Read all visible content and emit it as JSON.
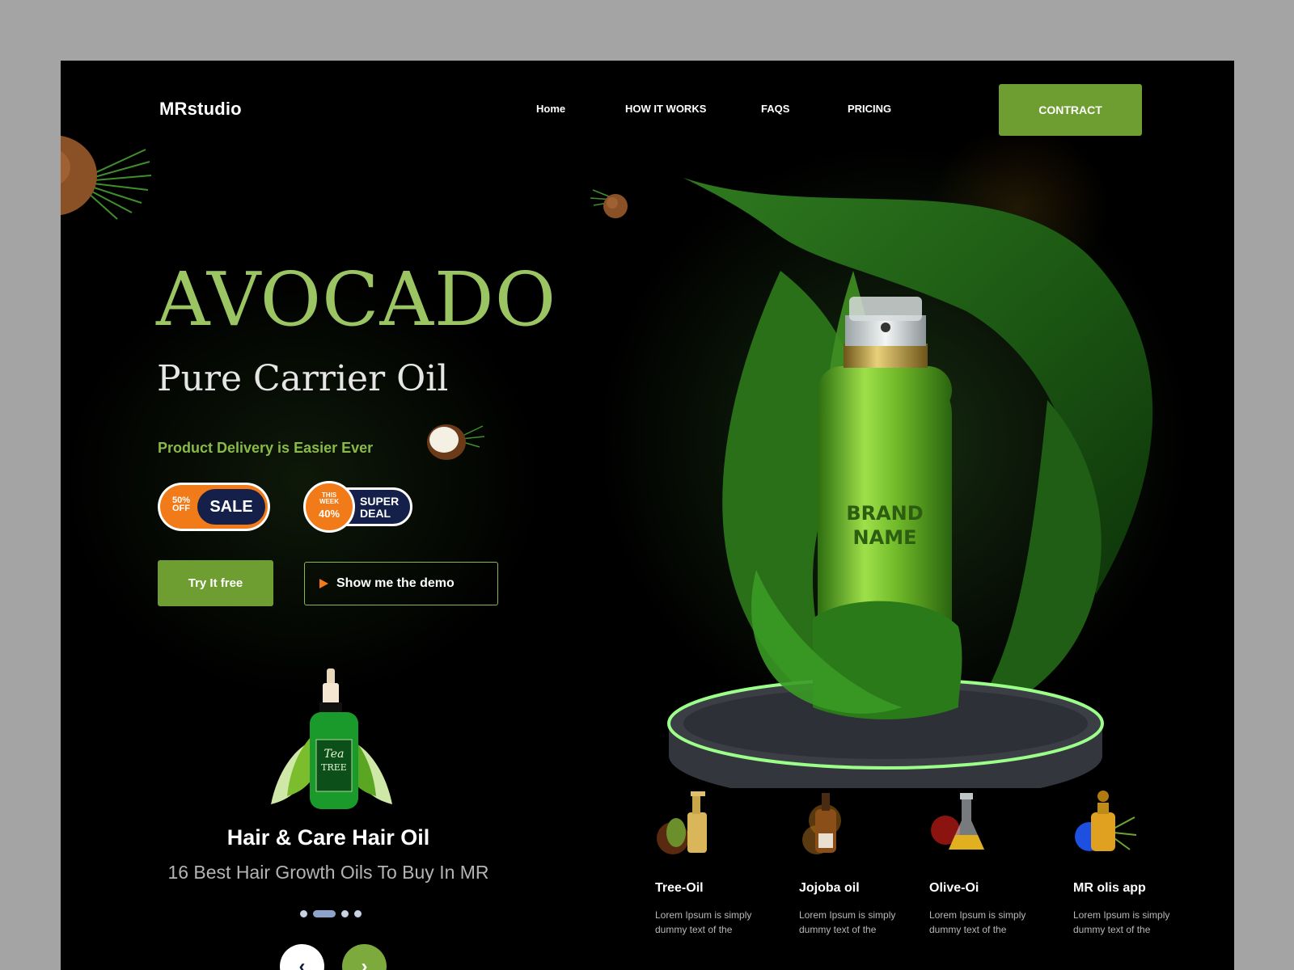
{
  "header": {
    "logo": "MRstudio",
    "nav": [
      {
        "label": "Home"
      },
      {
        "label": "HOW IT WORKS"
      },
      {
        "label": "FAQS"
      },
      {
        "label": "PRICING"
      }
    ],
    "cta_label": "CONTRACT"
  },
  "hero": {
    "title": "AVOCADO",
    "subtitle": "Pure Carrier Oil",
    "tagline": "Product Delivery is Easier Ever",
    "badge_sale": {
      "pct_line1": "50%",
      "pct_line2": "OFF",
      "word": "SALE"
    },
    "badge_deal": {
      "week_line1": "THIS",
      "week_line2": "WEEK",
      "pct": "40%",
      "line1": "SUPER",
      "line2": "DEAL"
    },
    "primary_button": "Try It free",
    "demo_button": "Show me the demo",
    "bottle_brand": "BRAND NAME"
  },
  "product": {
    "label_line1": "Tea",
    "label_line2": "TREE",
    "title": "Hair & Care Hair Oil",
    "subtitle": "16 Best Hair Growth Oils To Buy In MR",
    "slide_count": 4,
    "active_slide": 2,
    "prev_icon": "‹",
    "next_icon": "›"
  },
  "features": [
    {
      "name": "Tree-Oil",
      "desc": "Lorem Ipsum is simply dummy text of the",
      "icon": "gold-pump-bottle-avocado-icon"
    },
    {
      "name": "Jojoba oil",
      "desc": "Lorem Ipsum is simply dummy text of the",
      "icon": "amber-bottle-icon"
    },
    {
      "name": "Olive-Oi",
      "desc": "Lorem Ipsum is simply dummy text of the",
      "icon": "oil-flask-icon"
    },
    {
      "name": "MR olis app",
      "desc": "Lorem Ipsum is simply dummy text of the",
      "icon": "gold-oil-bottle-icon"
    }
  ],
  "colors": {
    "accent_green": "#6e9e32",
    "title_green": "#9bc462",
    "orange": "#f27b19",
    "navy": "#14204a",
    "page_bg": "#a4a4a4",
    "canvas_bg": "#000000"
  }
}
